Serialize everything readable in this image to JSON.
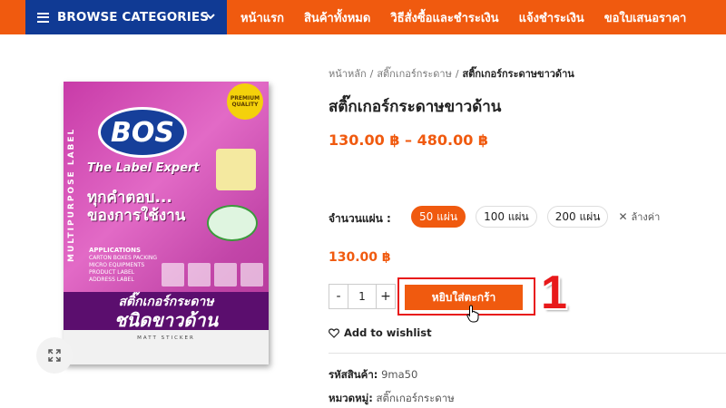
{
  "nav": {
    "browse_label": "BROWSE CATEGORIES",
    "menu": [
      "หน้าแรก",
      "สินค้าทั้งหมด",
      "วิธีสั่งซื้อและชำระเงิน",
      "แจ้งชำระเงิน",
      "ขอใบเสนอราคา"
    ]
  },
  "breadcrumb": {
    "home": "หน้าหลัก",
    "category": "สติ๊กเกอร์กระดาษ",
    "current": "สติ๊กเกอร์กระดาษขาวด้าน"
  },
  "product": {
    "title": "สติ๊กเกอร์กระดาษขาวด้าน",
    "price_range": "130.00 ฿ – 480.00 ฿",
    "qty_label": "จำนวนแผ่น :",
    "options": [
      "50 แผ่น",
      "100 แผ่น",
      "200 แผ่น"
    ],
    "selected_option": "50 แผ่น",
    "clear_label": "ล้างค่า",
    "selected_price": "130.00 ฿",
    "quantity": "1",
    "add_to_cart": "หยิบใส่ตะกร้า",
    "wishlist": "Add to wishlist",
    "sku_label": "รหัสสินค้า:",
    "sku": "9ma50",
    "category_label": "หมวดหมู่:",
    "category": "สติ๊กเกอร์กระดาษ"
  },
  "package": {
    "side_text": "MULTIPURPOSE LABEL",
    "brand": "BOS",
    "tagline": "The Label Expert",
    "badge": "PREMIUM QUALITY",
    "headline_1": "ทุกคำตอบ...",
    "headline_2": "ของการใช้งาน",
    "apps_title": "APPLICATIONS",
    "apps": [
      "CARTON BOXES PACKING",
      "MICRO EQUIPMENTS",
      "PRODUCT LABEL",
      "ADDRESS LABEL"
    ],
    "band_1": "สติ๊กเกอร์กระดาษ",
    "band_2": "ชนิดขาวด้าน",
    "matt": "MATT STICKER"
  },
  "annotation": {
    "step": "1"
  },
  "colors": {
    "accent": "#f05a0f",
    "nav_dark": "#103a94",
    "highlight": "#e8191a"
  }
}
